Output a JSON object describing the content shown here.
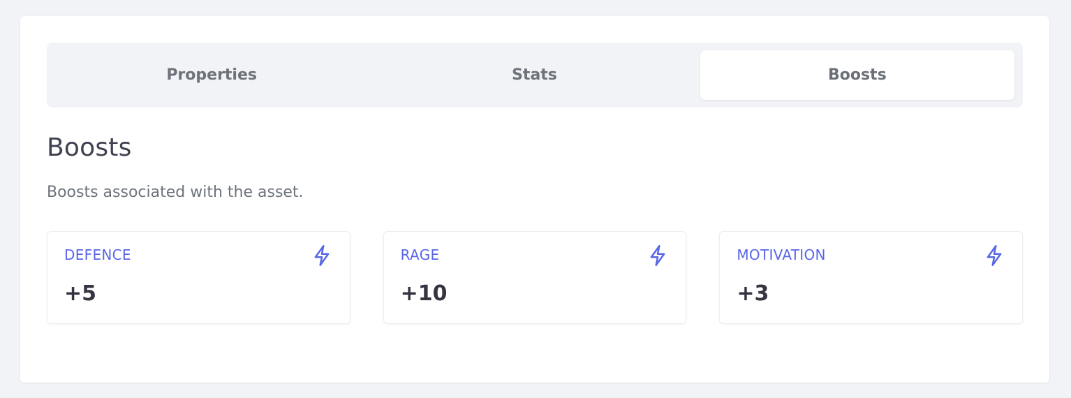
{
  "tabs": [
    {
      "label": "Properties"
    },
    {
      "label": "Stats"
    },
    {
      "label": "Boosts"
    }
  ],
  "active_tab": "Boosts",
  "section": {
    "title": "Boosts",
    "description": "Boosts associated with the asset."
  },
  "boosts": [
    {
      "name": "DEFENCE",
      "value": "+5",
      "icon": "lightning-bolt-icon"
    },
    {
      "name": "RAGE",
      "value": "+10",
      "icon": "lightning-bolt-icon"
    },
    {
      "name": "MOTIVATION",
      "value": "+3",
      "icon": "lightning-bolt-icon"
    }
  ],
  "colors": {
    "accent": "#5a66e6",
    "background": "#f1f3f7",
    "card": "#ffffff",
    "tab_bar": "#f2f3f6",
    "title_text": "#3f4150",
    "muted_text": "#6d737b"
  }
}
